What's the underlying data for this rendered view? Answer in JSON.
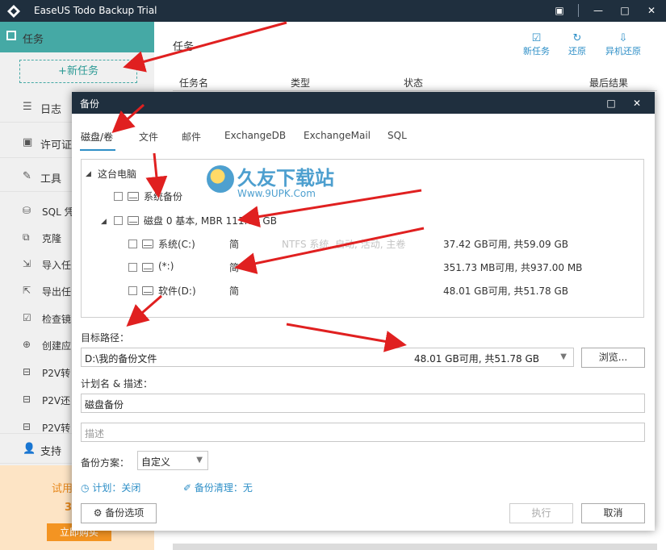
{
  "app": {
    "title": "EaseUS Todo Backup Trial",
    "window_buttons": [
      "▣",
      "—",
      "□",
      "✕"
    ]
  },
  "sidebar": {
    "task_label": "任务",
    "new_task_label": "+新任务",
    "items": [
      {
        "icon": "☰",
        "label": "日志"
      },
      {
        "icon": "▣",
        "label": "许可证"
      },
      {
        "icon": "✎",
        "label": "工具"
      }
    ],
    "subitems": [
      {
        "icon": "⛁",
        "label": "SQL 凭"
      },
      {
        "icon": "⧉",
        "label": "克隆"
      },
      {
        "icon": "⇲",
        "label": "导入任"
      },
      {
        "icon": "⇱",
        "label": "导出任"
      },
      {
        "icon": "☑",
        "label": "检查镜"
      },
      {
        "icon": "⊕",
        "label": "创建应"
      },
      {
        "icon": "⊟",
        "label": "P2V转"
      },
      {
        "icon": "⊟",
        "label": "P2V还"
      },
      {
        "icon": "⊟",
        "label": "P2V转"
      }
    ],
    "support_label": "支持",
    "trial": {
      "line1": "试用",
      "line2": "3",
      "buy": "立即购买"
    }
  },
  "main": {
    "header": "任务",
    "toolbar": [
      {
        "icon": "☑",
        "label": "新任务"
      },
      {
        "icon": "↻",
        "label": "还原"
      },
      {
        "icon": "⇩",
        "label": "异机还原"
      }
    ],
    "columns": [
      "任务名",
      "类型",
      "状态",
      "最后结果"
    ]
  },
  "dialog": {
    "title": "备份",
    "tabs": [
      "磁盘/卷",
      "文件",
      "邮件",
      "ExchangeDB",
      "ExchangeMail",
      "SQL"
    ],
    "tree": {
      "root": "这台电脑",
      "system_backup": "系统备份",
      "disk0": "磁盘 0 基本, MBR 111.79 GB",
      "partitions": [
        {
          "name": "系统(C:)",
          "type": "简",
          "info": "NTFS 系统, 启动, 活动, 主卷",
          "space": "37.42 GB可用, 共59.09 GB"
        },
        {
          "name": "(*:)",
          "type": "简",
          "info": "",
          "space": "351.73 MB可用, 共937.00 MB"
        },
        {
          "name": "软件(D:)",
          "type": "简",
          "info": "",
          "space": "48.01 GB可用, 共51.78 GB"
        }
      ]
    },
    "target_label": "目标路径：",
    "target_path": "D:\\我的备份文件",
    "target_space": "48.01 GB可用, 共51.78 GB",
    "browse_label": "浏览...",
    "plan_label": "计划名 & 描述：",
    "plan_name": "磁盘备份",
    "desc_placeholder": "描述",
    "scheme_label": "备份方案：",
    "scheme_value": "自定义",
    "schedule_label": "计划：关闭",
    "cleanup_label": "备份清理：无",
    "options_label": "备份选项",
    "execute_label": "执行",
    "cancel_label": "取消"
  },
  "watermark": {
    "title": "久友下载站",
    "url": "Www.9UPK.Com"
  },
  "colors": {
    "titlebar": "#1f2f3e",
    "accent": "#45a9a5",
    "link": "#2e8fc7",
    "trial_bg": "#fde4c5",
    "arrow": "#e02020"
  }
}
